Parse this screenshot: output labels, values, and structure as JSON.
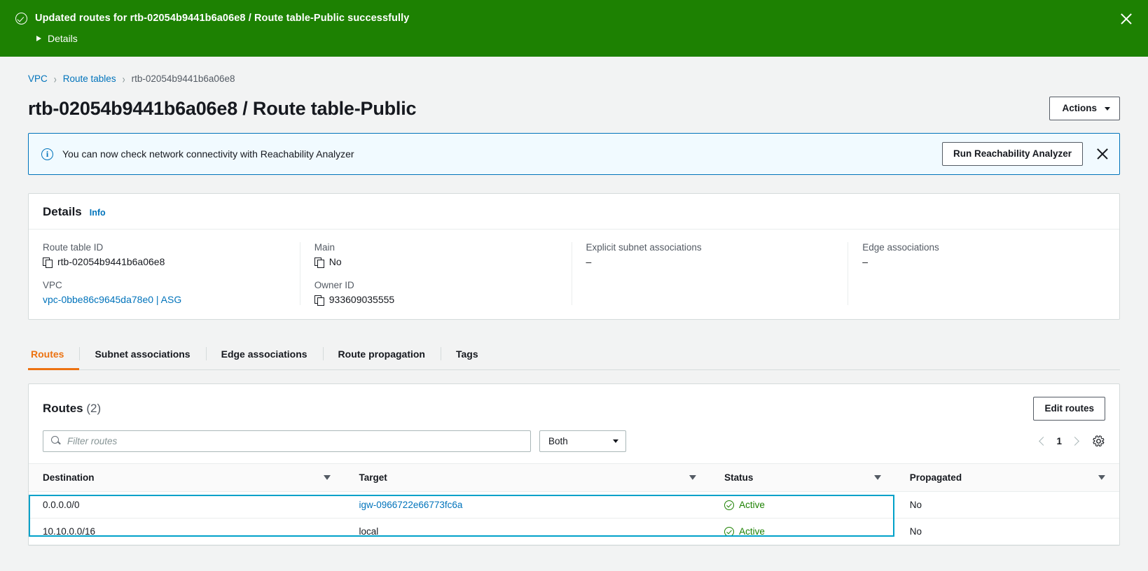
{
  "flash": {
    "icon": "check-circle-icon",
    "message": "Updated routes for rtb-02054b9441b6a06e8 / Route table-Public successfully",
    "details_label": "Details",
    "close_icon": "close-icon",
    "bg_color": "#1d8102"
  },
  "breadcrumb": {
    "items": [
      {
        "label": "VPC",
        "link": true
      },
      {
        "label": "Route tables",
        "link": true
      },
      {
        "label": "rtb-02054b9441b6a06e8",
        "link": false
      }
    ],
    "separator": "›"
  },
  "header": {
    "title": "rtb-02054b9441b6a06e8 / Route table-Public",
    "actions_label": "Actions"
  },
  "alert": {
    "icon": "info-circle-icon",
    "text": "You can now check network connectivity with Reachability Analyzer",
    "button_label": "Run Reachability Analyzer",
    "close_icon": "close-icon",
    "border_color": "#0073bb",
    "bg_color": "#f1faff"
  },
  "details": {
    "title": "Details",
    "info_label": "Info",
    "fields": [
      {
        "label": "Route table ID",
        "value": "rtb-02054b9441b6a06e8",
        "copy": true,
        "link": false
      },
      {
        "label": "VPC",
        "value": "vpc-0bbe86c9645da78e0 | ASG",
        "copy": false,
        "link": true
      },
      {
        "label": "Main",
        "value": "No",
        "copy": true,
        "link": false
      },
      {
        "label": "Owner ID",
        "value": "933609035555",
        "copy": true,
        "link": false
      },
      {
        "label": "Explicit subnet associations",
        "value": "–",
        "copy": false,
        "link": false
      },
      {
        "label": "Edge associations",
        "value": "–",
        "copy": false,
        "link": false
      }
    ]
  },
  "tabs": {
    "items": [
      {
        "label": "Routes",
        "active": true
      },
      {
        "label": "Subnet associations",
        "active": false
      },
      {
        "label": "Edge associations",
        "active": false
      },
      {
        "label": "Route propagation",
        "active": false
      },
      {
        "label": "Tags",
        "active": false
      }
    ],
    "active_color": "#ec7211"
  },
  "routes_panel": {
    "title": "Routes",
    "count": "(2)",
    "edit_button": "Edit routes",
    "search_placeholder": "Filter routes",
    "search_value": "",
    "search_icon": "search-icon",
    "filter_select": "Both",
    "page_number": "1",
    "prev_icon": "chevron-left-icon",
    "next_icon": "chevron-right-icon",
    "settings_icon": "gear-icon",
    "columns": [
      "Destination",
      "Target",
      "Status",
      "Propagated"
    ],
    "rows": [
      {
        "destination": "0.0.0.0/0",
        "target": "igw-0966722e66773fc6a",
        "target_is_link": true,
        "status": "Active",
        "propagated": "No"
      },
      {
        "destination": "10.10.0.0/16",
        "target": "local",
        "target_is_link": false,
        "status": "Active",
        "propagated": "No"
      }
    ],
    "status_color": "#1d8102",
    "selection_color": "#00a1c9"
  }
}
